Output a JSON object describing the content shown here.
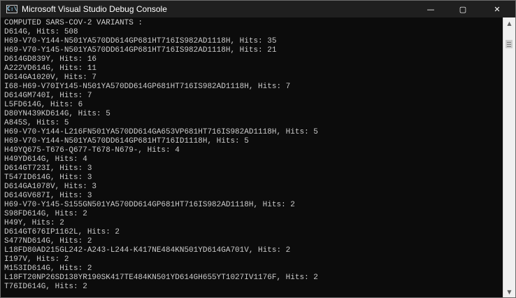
{
  "window": {
    "title": "Microsoft Visual Studio Debug Console",
    "icon_label": "C:\\",
    "minimize_glyph": "—",
    "maximize_glyph": "▢",
    "close_glyph": "✕"
  },
  "scrollbar": {
    "up_glyph": "▲",
    "down_glyph": "▼"
  },
  "console": {
    "lines": [
      "COMPUTED SARS-COV-2 VARIANTS :",
      "D614G, Hits: 508",
      "H69-V70-Y144-N501YA570DD614GP681HT716IS982AD1118H, Hits: 35",
      "H69-V70-Y145-N501YA570DD614GP681HT716IS982AD1118H, Hits: 21",
      "D614GD839Y, Hits: 16",
      "A222VD614G, Hits: 11",
      "D614GA1020V, Hits: 7",
      "I68-H69-V70IY145-N501YA570DD614GP681HT716IS982AD1118H, Hits: 7",
      "D614GM740I, Hits: 7",
      "L5FD614G, Hits: 6",
      "D80YN439KD614G, Hits: 5",
      "A845S, Hits: 5",
      "H69-V70-Y144-L216FN501YA570DD614GA653VP681HT716IS982AD1118H, Hits: 5",
      "H69-V70-Y144-N501YA570DD614GP681HT716ID1118H, Hits: 5",
      "H49YQ675-T676-Q677-T678-N679-, Hits: 4",
      "H49YD614G, Hits: 4",
      "D614GT723I, Hits: 3",
      "T547ID614G, Hits: 3",
      "D614GA1078V, Hits: 3",
      "D614GV687I, Hits: 3",
      "H69-V70-Y145-S155GN501YA570DD614GP681HT716IS982AD1118H, Hits: 2",
      "S98FD614G, Hits: 2",
      "H49Y, Hits: 2",
      "D614GT676IP1162L, Hits: 2",
      "S477ND614G, Hits: 2",
      "L18FD80AD215GL242-A243-L244-K417NE484KN501YD614GA701V, Hits: 2",
      "I197V, Hits: 2",
      "M153ID614G, Hits: 2",
      "L18FT20NP26SD138YR190SK417TE484KN501YD614GH655YT1027IV1176F, Hits: 2",
      "T76ID614G, Hits: 2"
    ]
  }
}
